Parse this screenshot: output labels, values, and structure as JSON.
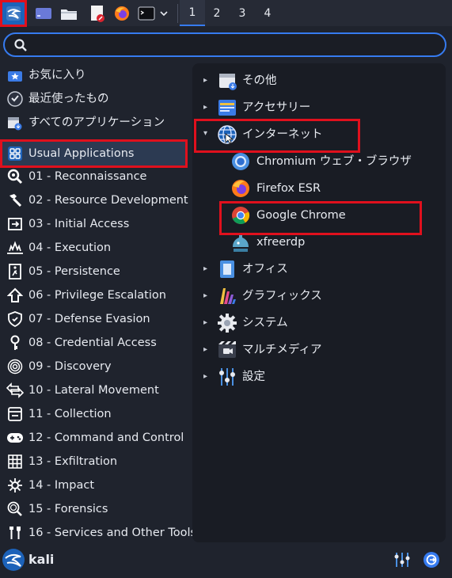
{
  "taskbar": {
    "workspaces": [
      "1",
      "2",
      "3",
      "4"
    ]
  },
  "search": {
    "placeholder": "",
    "value": ""
  },
  "left_menu": [
    {
      "label": "お気に入り",
      "icon": "star-icon"
    },
    {
      "label": "最近使ったもの",
      "icon": "recent-icon"
    },
    {
      "label": "すべてのアプリケーション",
      "icon": "all-apps-icon"
    },
    {
      "label": "Usual Applications",
      "icon": "grid-icon",
      "selected": true
    },
    {
      "label": "01 - Reconnaissance",
      "icon": "magnifier-icon"
    },
    {
      "label": "02 - Resource Development",
      "icon": "hammer-icon"
    },
    {
      "label": "03 - Initial Access",
      "icon": "door-icon"
    },
    {
      "label": "04 - Execution",
      "icon": "explosion-icon"
    },
    {
      "label": "05 - Persistence",
      "icon": "exit-icon"
    },
    {
      "label": "06 - Privilege Escalation",
      "icon": "arrow-up-icon"
    },
    {
      "label": "07 - Defense Evasion",
      "icon": "shield-icon"
    },
    {
      "label": "08 - Credential Access",
      "icon": "key-icon"
    },
    {
      "label": "09 - Discovery",
      "icon": "fingerprint-icon"
    },
    {
      "label": "10 - Lateral Movement",
      "icon": "lateral-arrows-icon"
    },
    {
      "label": "11 - Collection",
      "icon": "collection-icon"
    },
    {
      "label": "12 - Command and Control",
      "icon": "gamepad-icon"
    },
    {
      "label": "13 - Exfiltration",
      "icon": "exfil-grid-icon"
    },
    {
      "label": "14 - Impact",
      "icon": "impact-icon"
    },
    {
      "label": "15 - Forensics",
      "icon": "forensics-icon"
    },
    {
      "label": "16 - Services and Other Tools",
      "icon": "tools-icon"
    }
  ],
  "right_menu": {
    "categories": [
      {
        "label": "その他",
        "icon": "other-icon",
        "expanded": false
      },
      {
        "label": "アクセサリー",
        "icon": "accessories-icon",
        "expanded": false
      },
      {
        "label": "インターネット",
        "icon": "internet-globe-icon",
        "expanded": true
      },
      {
        "label": "オフィス",
        "icon": "office-icon",
        "expanded": false
      },
      {
        "label": "グラフィックス",
        "icon": "graphics-icon",
        "expanded": false
      },
      {
        "label": "システム",
        "icon": "system-gear-icon",
        "expanded": false
      },
      {
        "label": "マルチメディア",
        "icon": "multimedia-icon",
        "expanded": false
      },
      {
        "label": "設定",
        "icon": "settings-sliders-icon",
        "expanded": false
      }
    ],
    "internet_apps": [
      {
        "label": "Chromium ウェブ・ブラウザ",
        "icon": "chromium-icon"
      },
      {
        "label": "Firefox ESR",
        "icon": "firefox-icon"
      },
      {
        "label": "Google Chrome",
        "icon": "google-chrome-icon"
      },
      {
        "label": "xfreerdp",
        "icon": "xfreerdp-icon"
      }
    ]
  },
  "footer": {
    "username": "kali"
  },
  "colors": {
    "accent": "#367bf0",
    "highlight": "#e0101d",
    "panel": "#191c24",
    "background": "#1f232d"
  }
}
